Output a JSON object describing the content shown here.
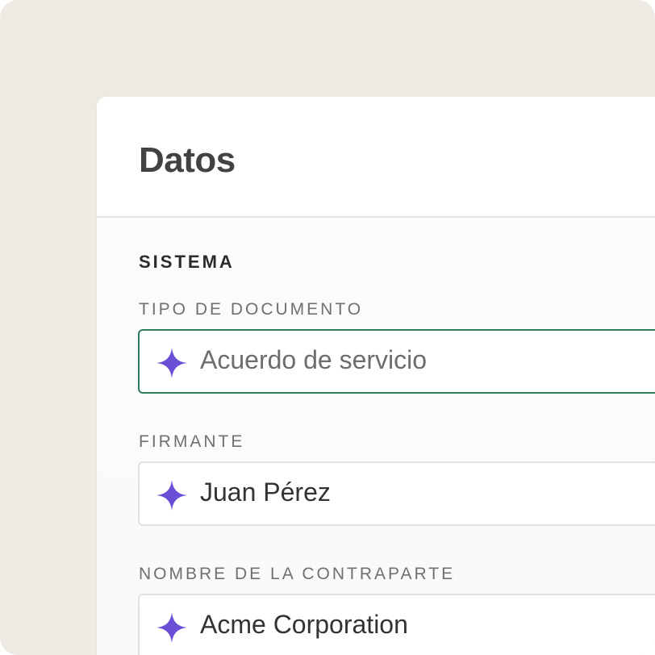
{
  "panel": {
    "title": "Datos"
  },
  "section": {
    "title": "SISTEMA"
  },
  "fields": [
    {
      "label": "TIPO DE DOCUMENTO",
      "value": "Acuerdo de servicio",
      "active": true,
      "icon": "sparkle-icon"
    },
    {
      "label": "FIRMANTE",
      "value": "Juan Pérez",
      "active": false,
      "icon": "sparkle-icon"
    },
    {
      "label": "NOMBRE DE LA CONTRAPARTE",
      "value": "Acme Corporation",
      "active": false,
      "icon": "sparkle-icon"
    }
  ],
  "colors": {
    "background": "#eeeae3",
    "card": "#ffffff",
    "accent_border": "#2e7d5b",
    "sparkle": "#6a4fd6",
    "title_text": "#424242"
  }
}
